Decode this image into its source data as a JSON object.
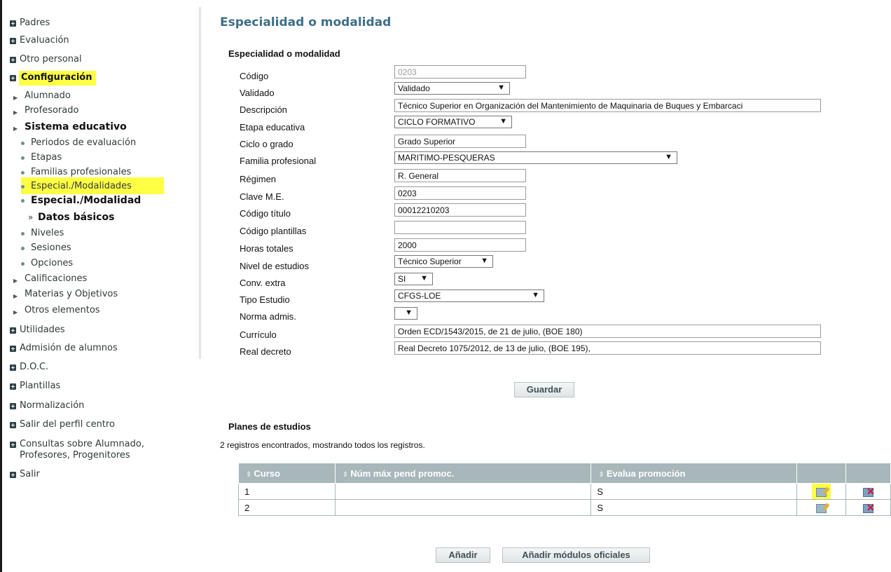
{
  "sidebar": {
    "padres": "Padres",
    "evaluacion": "Evaluación",
    "otro_personal": "Otro personal",
    "configuracion": "Configuración",
    "alumnado": "Alumnado",
    "profesorado": "Profesorado",
    "sistema_educativo": "Sistema educativo",
    "periodos": "Periodos de evaluación",
    "etapas": "Etapas",
    "familias": "Familias profesionales",
    "especial_modalidades": "Especial./Modalidades",
    "especial_modalidad": "Especial./Modalidad",
    "datos_basicos": "Datos básicos",
    "niveles": "Niveles",
    "sesiones": "Sesiones",
    "opciones": "Opciones",
    "calificaciones": "Calificaciones",
    "materias": "Materias y Objetivos",
    "otros_elementos": "Otros elementos",
    "utilidades": "Utilidades",
    "admision": "Admisión de alumnos",
    "doc": "D.O.C.",
    "plantillas": "Plantillas",
    "normalizacion": "Normalización",
    "salir_perfil": "Salir del perfil centro",
    "consultas_1": "Consultas sobre Alumnado,",
    "consultas_2": "Profesores, Progenitores",
    "salir": "Salir"
  },
  "page_title": "Especialidad o modalidad",
  "form": {
    "section_title": "Especialidad o modalidad",
    "labels": {
      "codigo": "Código",
      "validado": "Validado",
      "descripcion": "Descripción",
      "etapa": "Etapa educativa",
      "ciclo": "Ciclo o grado",
      "familia": "Familia profesional",
      "regimen": "Régimen",
      "clave": "Clave M.E.",
      "codigo_titulo": "Código título",
      "codigo_plantillas": "Código plantillas",
      "horas": "Horas totales",
      "nivel": "Nivel de estudios",
      "conv": "Conv. extra",
      "tipo": "Tipo Estudio",
      "norma": "Norma admis.",
      "curriculo": "Currículo",
      "real_decreto": "Real decreto"
    },
    "values": {
      "codigo": "0203",
      "validado": "Validado",
      "descripcion": "Técnico Superior en Organización del Mantenimiento de Maquinaria de Buques y Embarcaci",
      "etapa": "CICLO FORMATIVO",
      "ciclo": "Grado Superior",
      "familia": "MARITIMO-PESQUERAS",
      "regimen": "R. General",
      "clave": "0203",
      "codigo_titulo": "00012210203",
      "codigo_plantillas": "",
      "horas": "2000",
      "nivel": "Técnico Superior",
      "conv": "SI",
      "tipo": "CFGS-LOE",
      "norma": "",
      "curriculo": "Orden ECD/1543/2015, de 21 de julio, (BOE 180)",
      "real_decreto": "Real Decreto 1075/2012, de 13 de julio, (BOE 195),"
    },
    "dropdown_arrow": "▼",
    "save_label": "Guardar"
  },
  "planes": {
    "section_title": "Planes de estudios",
    "info": "2 registros encontrados, mostrando todos los registros.",
    "columns": [
      "Curso",
      "Núm máx pend promoc.",
      "Evalua promoción"
    ],
    "rows": [
      {
        "curso": "1",
        "num_max": "",
        "evalua": "S"
      },
      {
        "curso": "2",
        "num_max": "",
        "evalua": "S"
      }
    ],
    "add_label": "Añadir",
    "add_oficiales_label": "Añadir módulos oficiales"
  },
  "icons": [
    "plus-square-icon",
    "triangle-right-icon",
    "bullet-icon",
    "edit-icon",
    "delete-icon",
    "sort-icon"
  ],
  "colors": {
    "title": "#3d6f86",
    "table_header": "#a7b7ba",
    "highlight": "#ffff44"
  }
}
